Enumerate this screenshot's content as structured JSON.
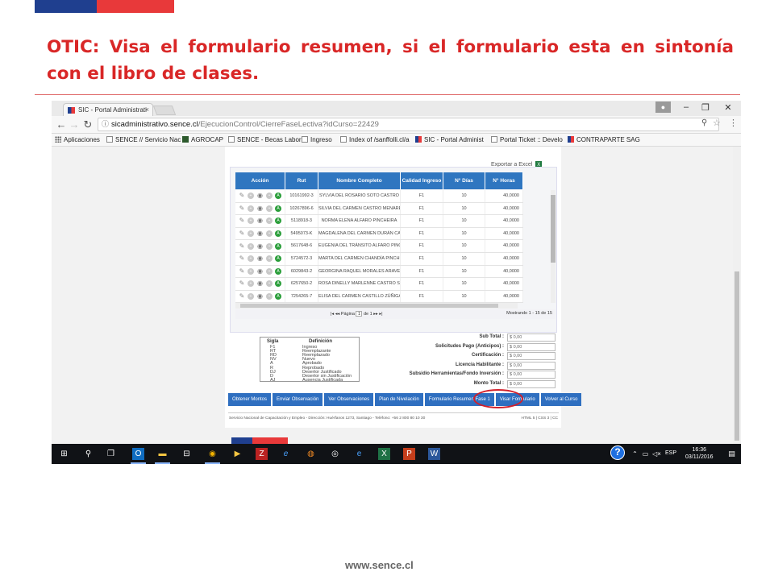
{
  "slide": {
    "title": "OTIC: Visa el formulario resumen, si el formulario esta en sintonía con el libro de clases.",
    "footer_url": "www.sence.cl"
  },
  "browser": {
    "tab_title": "SIC - Portal Administrati",
    "url_host": "sicadministrativo.sence.cl",
    "url_path": "/EjecucionControl/CierreFaseLectiva?idCurso=22429",
    "bookmarks": [
      "Aplicaciones",
      "SENCE // Servicio Nac",
      "AGROCAP",
      "SENCE - Becas Labora",
      "Ingreso",
      "Index of /sanffolli.cl/a",
      "SIC - Portal Administ",
      "Portal Ticket :: Develo",
      "CONTRAPARTE SAG"
    ]
  },
  "page": {
    "export_label": "Exportar a Excel",
    "columns": [
      "Acción",
      "Rut",
      "Nombre Completo",
      "Calidad Ingreso",
      "N° Días",
      "N° Horas"
    ],
    "rows": [
      {
        "rut": "10161992-3",
        "nombre": "SYLVIA DEL ROSARIO SOTO CASTRO",
        "calidad": "F1",
        "dias": "10",
        "horas": "40,0000"
      },
      {
        "rut": "10267896-6",
        "nombre": "SILVIA DEL CARMEN CASTRO MENARES",
        "calidad": "F1",
        "dias": "10",
        "horas": "40,0000"
      },
      {
        "rut": "5118918-3",
        "nombre": "NORMA ELENA ALFARO PINCHEIRA",
        "calidad": "F1",
        "dias": "10",
        "horas": "40,0000"
      },
      {
        "rut": "5495073-K",
        "nombre": "MAGDALENA DEL CARMEN DURÁN CAST",
        "calidad": "F1",
        "dias": "10",
        "horas": "40,0000"
      },
      {
        "rut": "5617648-6",
        "nombre": "EUGENIA DEL TRÁNSITO ALFARO PINCH",
        "calidad": "F1",
        "dias": "10",
        "horas": "40,0000"
      },
      {
        "rut": "5724572-3",
        "nombre": "MARTA DEL CARMEN CHANDÍA PINCHEI",
        "calidad": "F1",
        "dias": "10",
        "horas": "40,0000"
      },
      {
        "rut": "6029843-2",
        "nombre": "GEORGINA RAQUEL MORALES ARAVENA",
        "calidad": "F1",
        "dias": "10",
        "horas": "40,0000"
      },
      {
        "rut": "6257650-2",
        "nombre": "ROSA DINELLY MARLENNE CASTRO SANT",
        "calidad": "F1",
        "dias": "10",
        "horas": "40,0000"
      },
      {
        "rut": "7254265-7",
        "nombre": "ELISA DEL CARMEN CASTILLO ZÚÑIGA",
        "calidad": "F1",
        "dias": "10",
        "horas": "40,0000"
      }
    ],
    "pager": {
      "page_label": "Página",
      "page_value": "1",
      "of_label": "de 1",
      "summary": "Mostrando 1 - 15 de 15"
    },
    "legend": {
      "head_sigla": "Sigla",
      "head_def": "Definición",
      "items": [
        {
          "s": "F1",
          "d": "Ingreso"
        },
        {
          "s": "RT",
          "d": "Reemplazante"
        },
        {
          "s": "RD",
          "d": "Reemplazado"
        },
        {
          "s": "NV",
          "d": "Nuevo"
        },
        {
          "s": "A",
          "d": "Aprobado"
        },
        {
          "s": "R",
          "d": "Reprobado"
        },
        {
          "s": "DJ",
          "d": "Desertor Justificado"
        },
        {
          "s": "D",
          "d": "Desertor sin Justificación"
        },
        {
          "s": "AJ",
          "d": "Ausencia Justificada"
        }
      ]
    },
    "totals": [
      {
        "label": "Sub Total :",
        "value": "$ 0,00"
      },
      {
        "label": "Solicitudes Pago (Anticipos) :",
        "value": "$ 0,00"
      },
      {
        "label": "Certificación :",
        "value": "$ 0,00"
      },
      {
        "label": "Licencia Habilitante :",
        "value": "$ 0,00"
      },
      {
        "label": "Subsidio Herramientas/Fondo Inversión :",
        "value": "$ 0,00"
      },
      {
        "label": "Monto Total :",
        "value": "$ 0,00"
      }
    ],
    "buttons": [
      "Obtener Montos",
      "Enviar Observación",
      "Ver Observaciones",
      "Plan de Nivelación",
      "Formulario Resumen Fase 1",
      "Visar Formulario",
      "Volver al Curso"
    ],
    "footer_text": "Servicio Nacional de Capacitación y Empleo - Dirección: Huérfanos 1273, Santiago - Teléfono: +56 2 800 80 10 30",
    "footer_right": "HTML 5 | CSS 3 | CC"
  },
  "taskbar": {
    "lang": "ESP",
    "time": "16:36",
    "date": "03/11/2016"
  },
  "colors": {
    "title_red": "#d92727",
    "sence_blue": "#1f3f8f",
    "sence_red": "#e8393a",
    "button_blue": "#2f6fc0",
    "highlight_red": "#d21f2a"
  }
}
